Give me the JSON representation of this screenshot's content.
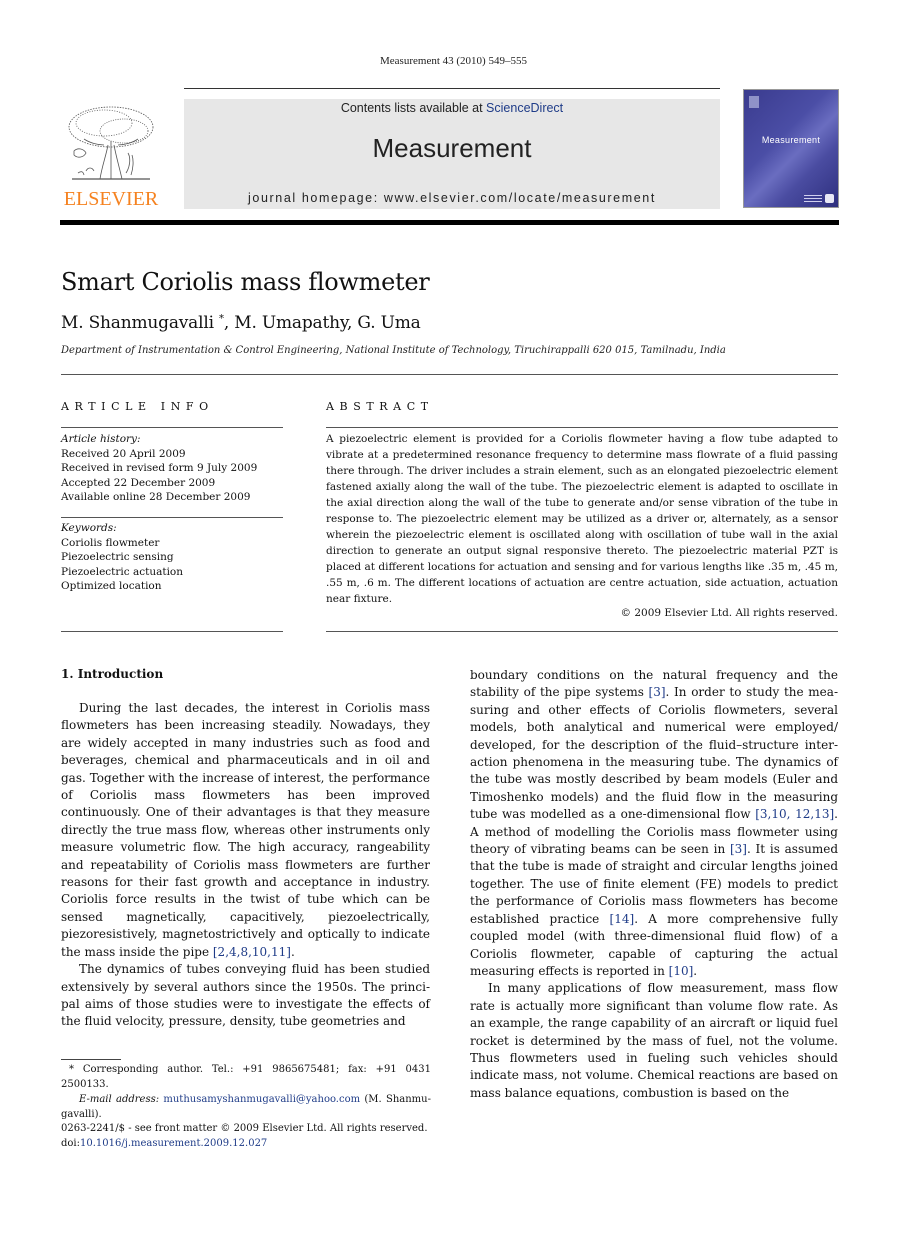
{
  "header": {
    "citation": "Measurement 43 (2010) 549–555",
    "contents_prefix": "Contents lists available at ",
    "contents_link": "ScienceDirect",
    "journal_name": "Measurement",
    "homepage": "journal homepage: www.elsevier.com/locate/measurement",
    "publisher_logo_text": "ELSEVIER",
    "cover_title": "Measurement",
    "colors": {
      "elsevier_orange": "#f58220",
      "link_blue": "#1f3c88",
      "banner_gray": "#e7e7e7",
      "cover_blue": "#3a3b8e"
    }
  },
  "article": {
    "title": "Smart Coriolis mass flowmeter",
    "authors_1": "M. Shanmugavalli ",
    "authors_star": "*",
    "authors_2": ", M. Umapathy, G. Uma",
    "affiliation": "Department of Instrumentation & Control Engineering, National Institute of Technology, Tiruchirappalli 620 015, Tamilnadu, India"
  },
  "article_info": {
    "heading": "ARTICLE INFO",
    "history_label": "Article history:",
    "history": [
      "Received 20 April 2009",
      "Received in revised form 9 July 2009",
      "Accepted 22 December 2009",
      "Available online 28 December 2009"
    ],
    "keywords_label": "Keywords:",
    "keywords": [
      "Coriolis flowmeter",
      "Piezoelectric sensing",
      "Piezoelectric actuation",
      "Optimized location"
    ]
  },
  "abstract": {
    "heading": "ABSTRACT",
    "text": "A piezoelectric element is provided for a Coriolis flowmeter having a flow tube adapted to vibrate at a predetermined resonance frequency to determine mass flowrate of a fluid pass­ing there through. The driver includes a strain element, such as an elongated piezoelectric element fastened axially along the wall of the tube. The piezoelectric element is adapted to oscillate in the axial direction along the wall of the tube to generate and/or sense vibration of the tube in response to. The piezoelectric element may be utilized as a driver or, alter­nately, as a sensor wherein the piezoelectric element is oscillated along with oscillation of tube wall in the axial direction to generate an output signal responsive thereto. The piezo­electric material PZT is placed at different locations for actuation and sensing and for var­ious lengths like .35 m, .45 m, .55 m, .6 m. The different locations of actuation are centre actuation, side actuation, actuation near fixture.",
    "copyright": "© 2009 Elsevier Ltd. All rights reserved."
  },
  "body": {
    "section_heading": "1.  Introduction",
    "left_p1_a": "During the last decades, the interest in Coriolis mass flowmeters has been increasing steadily. Nowadays, they are widely accepted in many industries such as food and beverages, chemical and pharmaceuticals and in oil and gas. Together with the increase of interest, the perfor­mance of Coriolis mass flowmeters has been improved continuously. One of their advantages is that they measure directly the true mass flow, whereas other instruments only measure volumetric flow. The high accuracy, range­ability and repeatability of Coriolis mass flowmeters are further reasons for their fast growth and acceptance in industry. Coriolis force results in the twist of tube which can be sensed magnetically, capacitively, piezoelectrically, piezoresistively, magnetostrictively and optically to indi­cate the mass inside the pipe ",
    "left_p1_ref": "[2,4,8,10,11]",
    "left_p1_b": ".",
    "left_p2": "The dynamics of tubes conveying fluid has been studied extensively by several authors since the 1950s. The princi­pal aims of those studies were to investigate the effects of the fluid velocity, pressure, density, tube geometries and",
    "right_p1_a": "boundary conditions on the natural frequency and the stability of the pipe systems ",
    "right_p1_ref1": "[3]",
    "right_p1_b": ". In order to study the mea­suring and other effects of Coriolis flowmeters, several models, both analytical and numerical were employed/ developed, for the description of the fluid–structure inter­action phenomena in the measuring tube. The dynamics of the tube was mostly described by beam models (Euler and Timoshenko models) and the fluid flow in the measuring tube was modelled as a one-dimensional flow ",
    "right_p1_ref2": "[3,10, 12,13]",
    "right_p1_c": ". A method of modelling the Coriolis mass flowmeter using theory of vibrating beams can be seen in ",
    "right_p1_ref3": "[3]",
    "right_p1_d": ". It is as­sumed that the tube is made of straight and circular lengths joined together. The use of finite element (FE) models to predict the performance of Coriolis mass flow­meters has become established practice ",
    "right_p1_ref4": "[14]",
    "right_p1_e": ". A more com­prehensive fully coupled model (with three-dimensional fluid flow) of a Coriolis flowmeter, capable of capturing the actual measuring effects is reported in ",
    "right_p1_ref5": "[10]",
    "right_p1_f": ".",
    "right_p2": "In many applications of flow measurement, mass flow rate is actually more significant than volume flow rate. As an example, the range capability of an aircraft or liquid fuel rocket is determined by the mass of fuel, not the vol­ume. Thus flowmeters used in fueling such vehicles should indicate mass, not volume. Chemical reactions are based on mass balance equations, combustion is based on the"
  },
  "footnote": {
    "corresponding": "*  Corresponding author. Tel.: +91 9865675481; fax: +91 0431 2500133.",
    "email_label": "E-mail address: ",
    "email": "muthusamyshanmugavalli@yahoo.com",
    "email_suffix": " (M. Shanmu­gavalli).",
    "front_matter": "0263-2241/$ - see front matter © 2009 Elsevier Ltd. All rights reserved.",
    "doi_prefix": "doi:",
    "doi": "10.1016/j.measurement.2009.12.027"
  }
}
